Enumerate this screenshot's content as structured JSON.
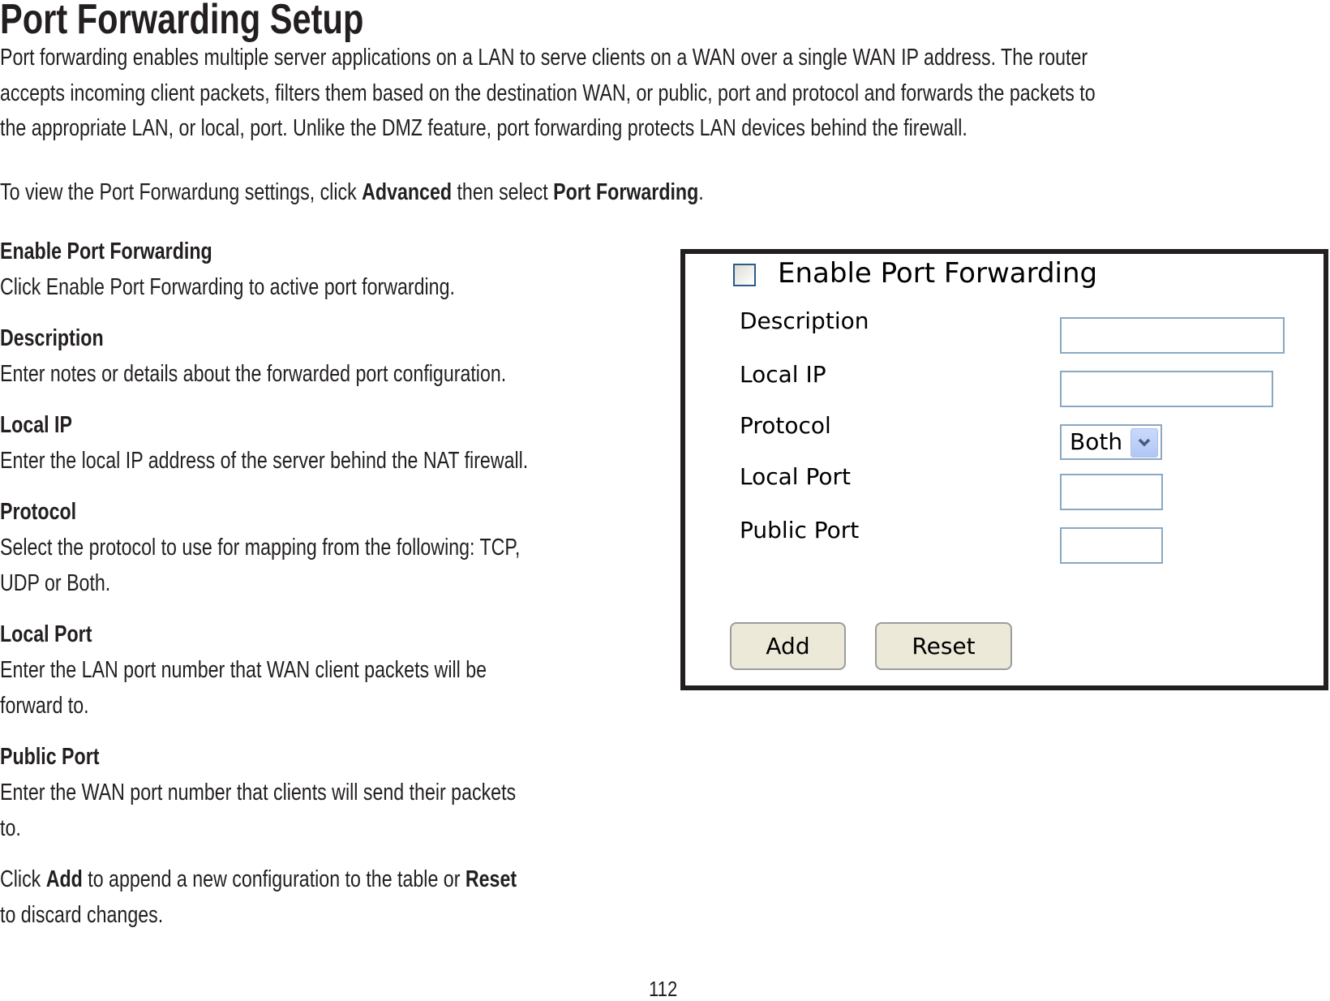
{
  "page": {
    "title": "Port Forwarding Setup",
    "intro_lines": [
      "Port forwarding enables multiple server applications on a LAN to serve clients on a WAN over a single WAN IP address. The router",
      "accepts incoming client packets, filters them based on the destination WAN, or public, port and protocol and forwards the packets to",
      "the appropriate LAN, or local, port. Unlike the DMZ feature, port forwarding protects LAN devices behind the firewall."
    ],
    "nav_instruction": {
      "prefix": "To view the Port Forwardung settings, click ",
      "menu": "Advanced",
      "middle": " then select ",
      "item": "Port Forwarding",
      "suffix": "."
    },
    "sections": [
      {
        "heading": "Enable Port Forwarding",
        "lines": [
          "Click Enable Port Forwarding to active port forwarding."
        ]
      },
      {
        "heading": "Description",
        "lines": [
          "Enter notes or details about the forwarded port configuration."
        ]
      },
      {
        "heading": "Local IP",
        "lines": [
          "Enter the local IP address of the server behind the NAT firewall."
        ]
      },
      {
        "heading": "Protocol",
        "lines": [
          "Select the protocol to use for mapping from the following: TCP,",
          "UDP or Both."
        ]
      },
      {
        "heading": "Local Port",
        "lines": [
          "Enter the LAN port number that WAN client packets will be",
          "forward to."
        ]
      },
      {
        "heading": "Public Port",
        "lines": [
          "Enter the WAN port number that clients will send their packets",
          "to."
        ]
      }
    ],
    "closing": {
      "line1_prefix": "Click ",
      "add": "Add",
      "line1_middle": " to append a new configuration to the table or ",
      "reset": "Reset",
      "line2": "to discard changes."
    },
    "page_number": "112"
  },
  "form": {
    "enable_label": "Enable Port Forwarding",
    "enable_checked": false,
    "fields": {
      "description": {
        "label": "Description",
        "value": ""
      },
      "local_ip": {
        "label": "Local IP",
        "value": ""
      },
      "protocol": {
        "label": "Protocol",
        "selected": "Both"
      },
      "local_port": {
        "label": "Local Port",
        "value": ""
      },
      "public_port": {
        "label": "Public Port",
        "value": ""
      }
    },
    "buttons": {
      "add": "Add",
      "reset": "Reset"
    },
    "colors": {
      "input_border": "#8aa8c2",
      "button_fill": "#ece9d8",
      "checkbox_border": "#2b5a8c",
      "panel_border": "#231f20"
    }
  }
}
